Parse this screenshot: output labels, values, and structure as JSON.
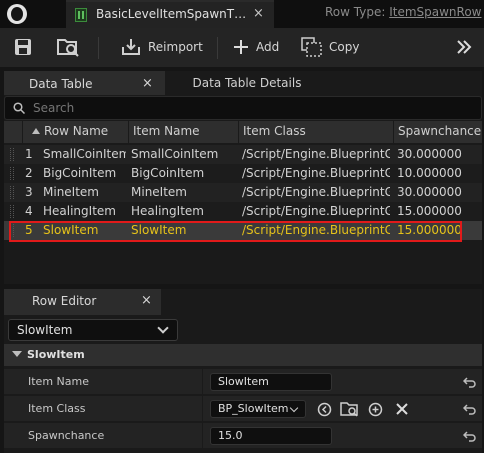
{
  "window": {
    "tab_title": "BasicLevelItemSpawnT…",
    "row_type_label": "Row Type:",
    "row_type_value": "ItemSpawnRow"
  },
  "toolbar": {
    "reimport_label": "Reimport",
    "add_label": "Add",
    "copy_label": "Copy"
  },
  "tabs": {
    "data_table": "Data Table",
    "data_table_details": "Data Table Details",
    "close_glyph": "×"
  },
  "search": {
    "placeholder": "Search"
  },
  "table": {
    "columns": [
      "Row Name",
      "Item Name",
      "Item Class",
      "Spawnchance"
    ],
    "rows": [
      {
        "index": "1",
        "row_name": "SmallCoinItem",
        "item_name": "SmallCoinItem",
        "item_class": "/Script/Engine.BlueprintGen",
        "spawnchance": "30.000000"
      },
      {
        "index": "2",
        "row_name": "BigCoinItem",
        "item_name": "BigCoinItem",
        "item_class": "/Script/Engine.BlueprintGen",
        "spawnchance": "10.000000"
      },
      {
        "index": "3",
        "row_name": "MineItem",
        "item_name": "MineItem",
        "item_class": "/Script/Engine.BlueprintGen",
        "spawnchance": "30.000000"
      },
      {
        "index": "4",
        "row_name": "HealingItem",
        "item_name": "HealingItem",
        "item_class": "/Script/Engine.BlueprintGen",
        "spawnchance": "15.000000"
      },
      {
        "index": "5",
        "row_name": "SlowItem",
        "item_name": "SlowItem",
        "item_class": "/Script/Engine.BlueprintGen",
        "spawnchance": "15.000000"
      }
    ],
    "selected_index": 4
  },
  "row_editor": {
    "tab_label": "Row Editor",
    "selected_row": "SlowItem",
    "category": "SlowItem",
    "properties": {
      "item_name_label": "Item Name",
      "item_name_value": "SlowItem",
      "item_class_label": "Item Class",
      "item_class_value": "BP_SlowItem",
      "spawnchance_label": "Spawnchance",
      "spawnchance_value": "15.0"
    }
  },
  "colors": {
    "selected_text": "#e6c21a",
    "selection_outline": "#e11a1a",
    "accent_green": "#5fbf5f",
    "background": "#151515"
  },
  "icons": [
    "unreal-logo-icon",
    "datatable-icon",
    "save-icon",
    "browse-icon",
    "reimport-icon",
    "add-icon",
    "copy-icon",
    "overflow-chevrons-icon",
    "search-icon",
    "sort-arrow-icon",
    "chevron-down-icon",
    "use-selected-icon",
    "browse-asset-icon",
    "add-circle-icon",
    "clear-icon",
    "reset-arrow-icon"
  ]
}
